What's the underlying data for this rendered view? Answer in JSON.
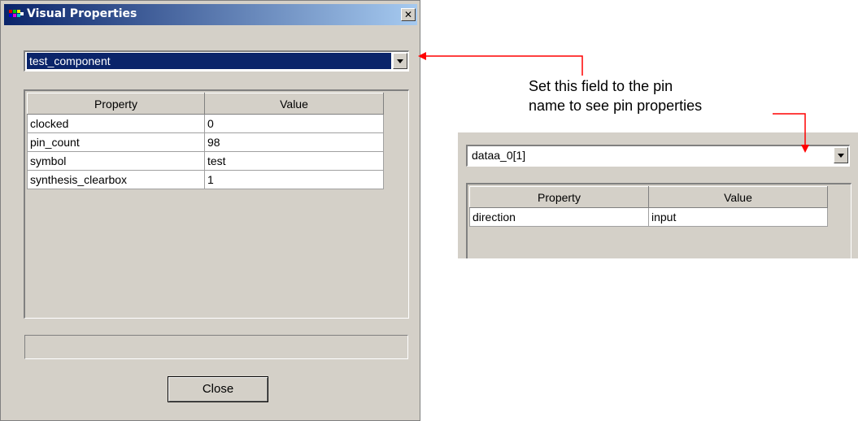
{
  "dialog": {
    "title": "Visual Properties",
    "close_glyph": "✕",
    "combo_value": "test_component",
    "table": {
      "headers": [
        "Property",
        "Value"
      ],
      "rows": [
        [
          "clocked",
          "0"
        ],
        [
          "pin_count",
          "98"
        ],
        [
          "symbol",
          "test"
        ],
        [
          "synthesis_clearbox",
          "1"
        ]
      ]
    },
    "close_button_label": "Close"
  },
  "annotation": {
    "line1": "Set this field to the pin",
    "line2": "name to see pin properties",
    "arrow_color": "#ff0000"
  },
  "pin_view": {
    "combo_value": "dataa_0[1]",
    "table": {
      "headers": [
        "Property",
        "Value"
      ],
      "rows": [
        [
          "direction",
          "input"
        ]
      ]
    }
  },
  "colors": {
    "title_gradient_start": "#0a246a",
    "title_gradient_end": "#a6caf0",
    "window_face": "#d4d0c8",
    "selection": "#0a246a"
  }
}
